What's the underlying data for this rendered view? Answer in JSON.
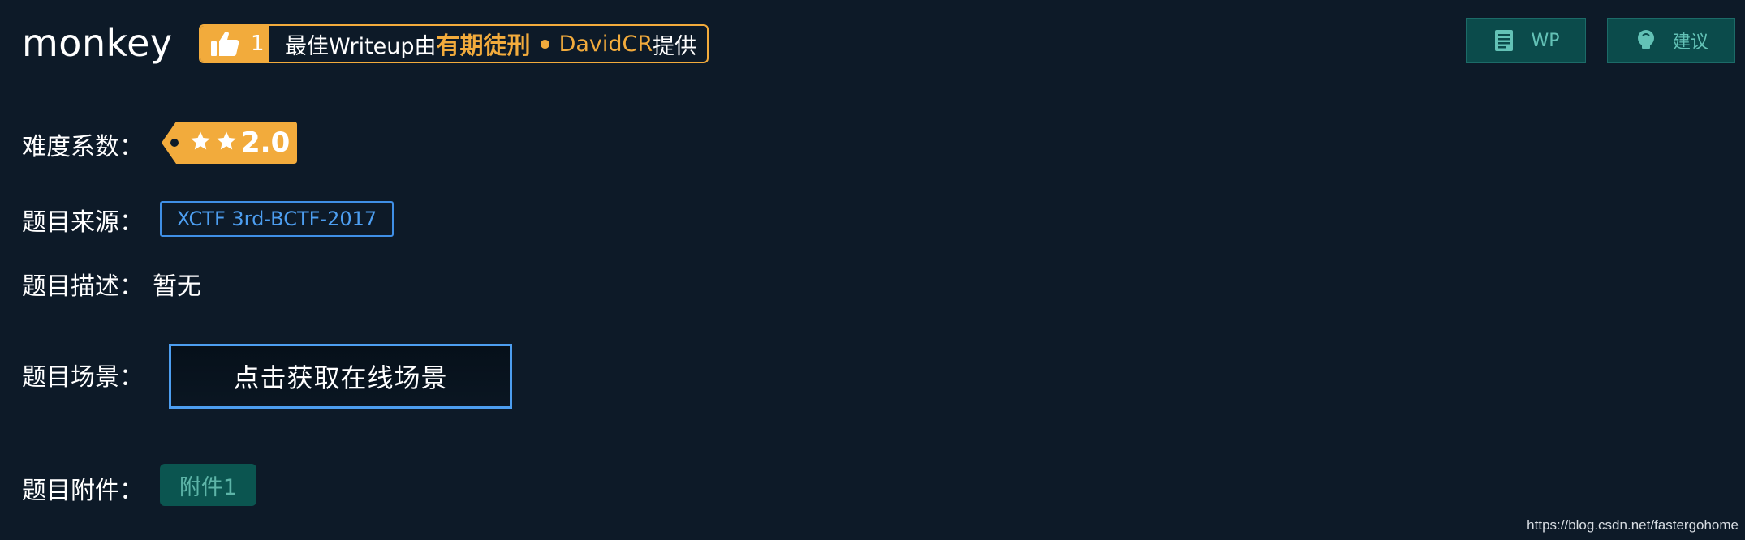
{
  "challenge": {
    "title": "monkey",
    "likes": "1",
    "writeup_prefix": "最佳Writeup由",
    "writeup_team": "有期徒刑",
    "writeup_author": "DavidCR",
    "writeup_suffix": "提供"
  },
  "toolbar": {
    "wp_label": "WP",
    "suggest_label": "建议"
  },
  "fields": {
    "difficulty_label": "难度系数：",
    "difficulty_value": "2.0",
    "difficulty_stars": 2,
    "source_label": "题目来源：",
    "source_value": "XCTF 3rd-BCTF-2017",
    "description_label": "题目描述：",
    "description_value": "暂无",
    "scene_label": "题目场景：",
    "scene_button": "点击获取在线场景",
    "attachment_label": "题目附件：",
    "attachment_button": "附件1"
  },
  "watermark": "https://blog.csdn.net/fastergohome",
  "colors": {
    "background": "#0d1a28",
    "accent_orange": "#f2ab3c",
    "accent_blue": "#4d9ef0",
    "accent_teal": "#0b5550"
  },
  "icons": {
    "like": "thumbs-up-icon",
    "wp": "document-icon",
    "suggest": "lightbulb-icon",
    "star": "star-icon"
  }
}
